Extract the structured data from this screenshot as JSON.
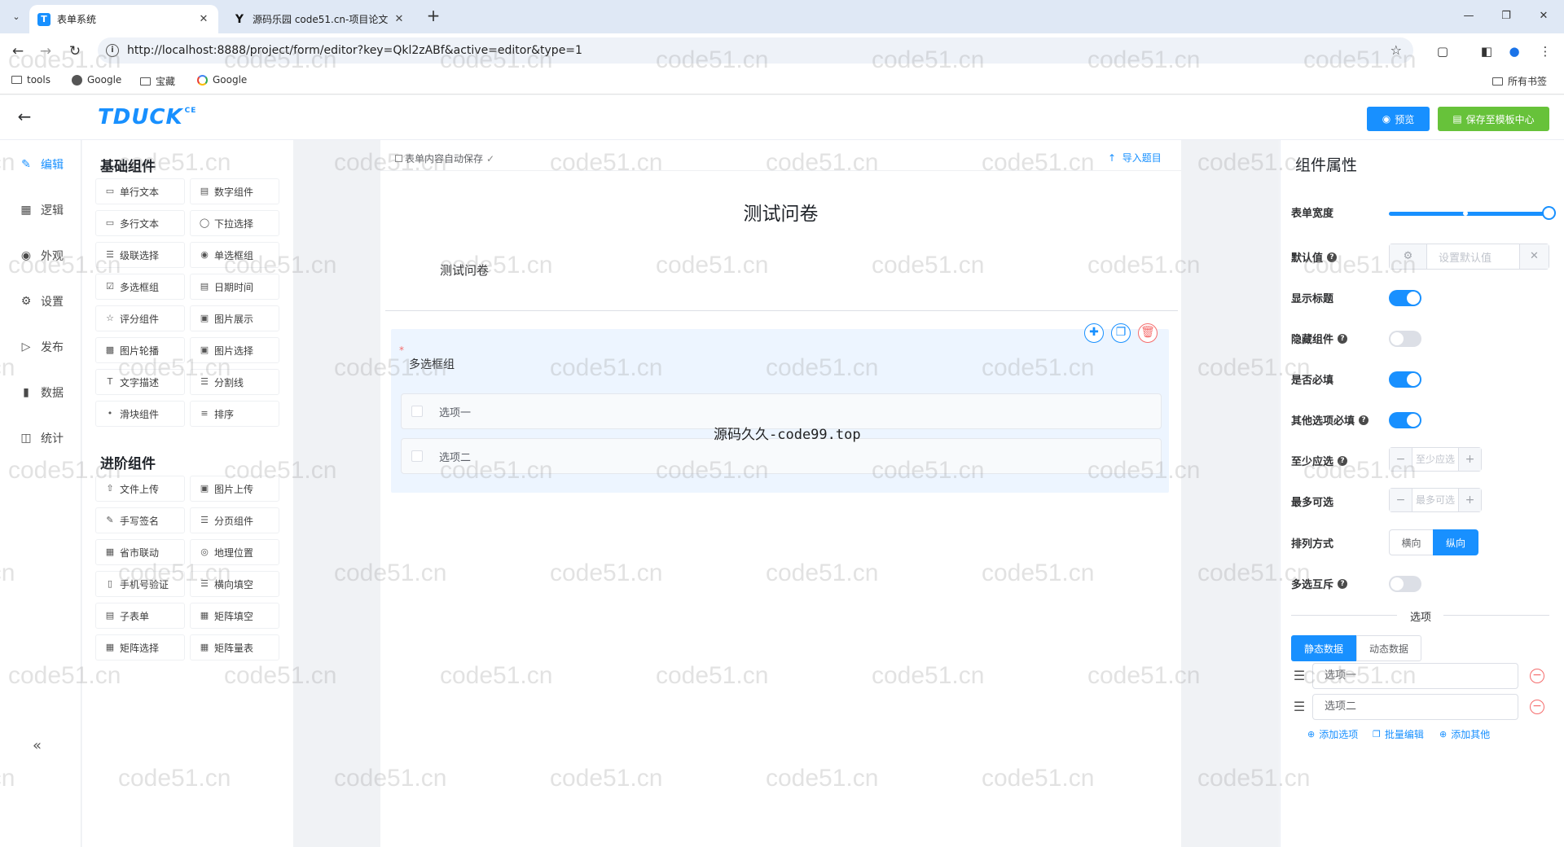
{
  "browser": {
    "tabs": [
      {
        "title": "表单系统",
        "favicon": "T",
        "active": true
      },
      {
        "title": "源码乐园 code51.cn-项目论文",
        "favicon": "Y",
        "active": false
      }
    ],
    "url": "http://localhost:8888/project/form/editor?key=Qkl2zABf&active=editor&type=1",
    "bookmarks": [
      "tools",
      "Google",
      "宝藏",
      "Google"
    ],
    "all_bookmarks": "所有书签"
  },
  "header": {
    "logo": "TDUCK",
    "logo_sup": "CE",
    "preview_label": "预览",
    "save_template_label": "保存至模板中心"
  },
  "rail": [
    {
      "label": "编辑",
      "icon": "edit-icon"
    },
    {
      "label": "逻辑",
      "icon": "grid-icon"
    },
    {
      "label": "外观",
      "icon": "eye-icon"
    },
    {
      "label": "设置",
      "icon": "gear-icon"
    },
    {
      "label": "发布",
      "icon": "play-icon"
    },
    {
      "label": "数据",
      "icon": "bar-chart-icon"
    },
    {
      "label": "统计",
      "icon": "stats-icon"
    }
  ],
  "palette": {
    "basic_title": "基础组件",
    "basic": [
      "单行文本",
      "数字组件",
      "多行文本",
      "下拉选择",
      "级联选择",
      "单选框组",
      "多选框组",
      "日期时间",
      "评分组件",
      "图片展示",
      "图片轮播",
      "图片选择",
      "文字描述",
      "分割线",
      "滑块组件",
      "排序"
    ],
    "advanced_title": "进阶组件",
    "advanced": [
      "文件上传",
      "图片上传",
      "手写签名",
      "分页组件",
      "省市联动",
      "地理位置",
      "手机号验证",
      "横向填空",
      "子表单",
      "矩阵填空",
      "矩阵选择",
      "矩阵量表"
    ]
  },
  "canvas": {
    "autosave": "表单内容自动保存",
    "import_label": "导入题目",
    "form_title": "测试问卷",
    "form_description": "测试问卷",
    "field_label": "多选框组",
    "options": [
      "选项一",
      "选项二"
    ],
    "overlay_text": "源码久久-code99.top"
  },
  "props": {
    "title": "组件属性",
    "width_label": "表单宽度",
    "width_value_fraction": 1.0,
    "default_label": "默认值",
    "default_placeholder": "设置默认值",
    "show_title_label": "显示标题",
    "show_title": true,
    "hide_label": "隐藏组件",
    "hide": false,
    "required_label": "是否必填",
    "required": true,
    "other_required_label": "其他选项必填",
    "other_required": true,
    "min_label": "至少应选",
    "min_placeholder": "至少应选",
    "max_label": "最多可选",
    "max_placeholder": "最多可选",
    "layout_label": "排列方式",
    "layout_options": [
      "横向",
      "纵向"
    ],
    "layout_selected": "纵向",
    "exclusive_label": "多选互斥",
    "exclusive": false,
    "options_section": "选项",
    "data_tabs": [
      "静态数据",
      "动态数据"
    ],
    "option_values": [
      "选项一",
      "选项二"
    ],
    "add_option": "添加选项",
    "batch_edit": "批量编辑",
    "add_other": "添加其他"
  },
  "watermark": "code51.cn",
  "colors": {
    "primary": "#1890ff",
    "success": "#67c23a",
    "danger": "#f56c6c"
  }
}
